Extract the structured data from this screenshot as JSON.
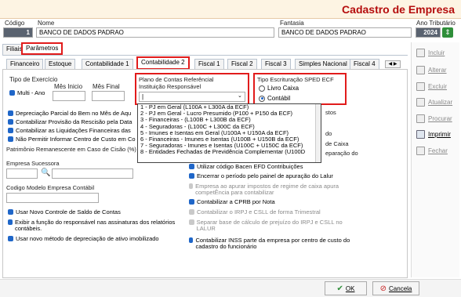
{
  "header": {
    "title": "Cadastro de Empresa"
  },
  "top_fields": {
    "codigo_label": "Código",
    "codigo_value": "1",
    "nome_label": "Nome",
    "nome_value": "BANCO DE DADOS PADRAO",
    "fantasia_label": "Fantasia",
    "fantasia_value": "BANCO DE DADOS PADRAO",
    "ano_label": "Ano Tributário",
    "ano_value": "2024"
  },
  "main_tabs": [
    "Filiais",
    "Parâmetros"
  ],
  "sub_tabs": [
    "Financeiro",
    "Estoque",
    "Contabilidade 1",
    "Contabilidade 2",
    "Fiscal 1",
    "Fiscal 2",
    "Fiscal 3",
    "Simples Nacional",
    "Fiscal 4"
  ],
  "exercicio": {
    "group_label": "Tipo de Exercício",
    "multi_ano_label": "Multi - Ano",
    "mes_inicio_label": "Mês Inicio",
    "mes_final_label": "Mês Final"
  },
  "plano_contas": {
    "title": "Plano de Contas Referêncial",
    "responsavel_label": "Instituição Responsável",
    "selected_value": "|",
    "options": [
      "1 - PJ em Geral (L100A + L300A da ECF)",
      "2 - PJ em Geral - Lucro Presumido (P100 + P150 da ECF)",
      "3 - Financeiras - (L100B + L300B da ECF)",
      "4 - Seguradoras - (L100C + L300C da ECF)",
      "5 - Imunes e Isentas em Geral (U100A + U150A da ECF)",
      "6 - Financeiras - Imunes e Isentas (U100B + U150B da ECF)",
      "7 - Seguradoras - Imunes e Isentas (U100C + U150C da ECF)",
      "8 - Entidades Fechadas de Previdência Complementar (U100D"
    ]
  },
  "sped": {
    "title": "Tipo Escrituração SPED ECF",
    "option_livro": "Livro Caixa",
    "option_contabil": "Contábil"
  },
  "left_checks": [
    "Depreciação Parcial do Bem no Mês de Aqu",
    "Contabilizar Provisão da Rescisão pela Data",
    "Contabilizar as Liquidações Financeiras das",
    "Não Permitir Informar Centro de Custo em Co"
  ],
  "patrimonio_label": "Patrimônio Remanescente em Caso de Cisão (%)",
  "empresa_sucessora_label": "Empresa Sucessora",
  "codigo_modelo_label": "Codigo Modelo Empresa Contábil",
  "bottom_left_checks": [
    "Usar Novo Controle de Saldo de Contas",
    "Exibir a função do responsável nas assinaturas dos relatórios contábeis.",
    "Usar novo método de depreciação de ativo imobilizado"
  ],
  "right_fragments": [
    "stos",
    "do",
    "de Caixa",
    "eparação do"
  ],
  "right_checks": [
    {
      "label": "Utilizar código Bacen EFD Contribuições",
      "enabled": true
    },
    {
      "label": "Encerrar o período pelo painel de apuração do Lalur",
      "enabled": true
    },
    {
      "label": "Empresa ao apurar impostos de regime de caixa apura competÊncia para contabilizar",
      "enabled": false
    },
    {
      "label": "Contabilizar a CPRB por Nota",
      "enabled": true
    },
    {
      "label": "Contabilizar o IRPJ e CSLL de forma Trimestral",
      "enabled": false
    },
    {
      "label": "Separar base de cálculo de prejuízo do IRPJ e CSLL no LALUR",
      "enabled": false
    },
    {
      "label": "Contabilizar INSS parte da empresa por centro de custo do cadastro do funcionário",
      "enabled": true
    }
  ],
  "side_buttons": [
    {
      "label": "Incluir",
      "enabled": false,
      "icon": "add-icon"
    },
    {
      "label": "Alterar",
      "enabled": false,
      "icon": "edit-icon"
    },
    {
      "label": "Excluir",
      "enabled": false,
      "icon": "delete-icon"
    },
    {
      "label": "Atualizar",
      "enabled": false,
      "icon": "refresh-icon"
    },
    {
      "label": "Procurar",
      "enabled": false,
      "icon": "search-icon"
    },
    {
      "label": "Imprimir",
      "enabled": true,
      "icon": "print-icon"
    },
    {
      "label": "Fechar",
      "enabled": false,
      "icon": "close-icon"
    }
  ],
  "footer": {
    "ok_label": "OK",
    "cancel_label": "Cancela"
  },
  "colors": {
    "title_red": "#b50d0d",
    "highlight_red": "#e11b1b",
    "accent_blue": "#1f66c8",
    "selection_blue": "#0a63d3"
  }
}
